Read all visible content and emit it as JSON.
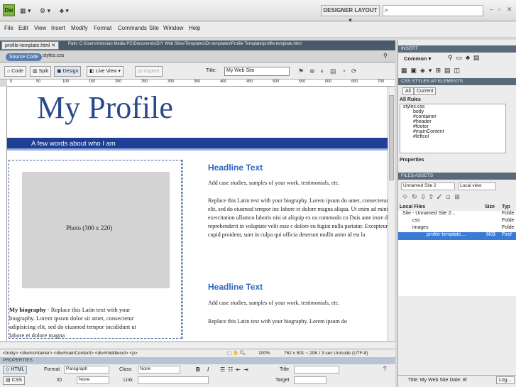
{
  "app": {
    "logo": "Dw",
    "layout": "DESIGNER LAYOUT",
    "search_placeholder": ""
  },
  "menu": [
    "File",
    "Edit",
    "View",
    "Insert",
    "Modify",
    "Format",
    "Commands",
    "Site",
    "Window",
    "Help"
  ],
  "doc": {
    "tab": "profile-template.html",
    "path": "Path: C:\\Users\\Artesian Media PC\\Documents\\DIY Web Sites\\Templates\\Dr-templates\\Profile Template\\profile-template.html",
    "source": "Source Code",
    "related": "styles.css"
  },
  "toolbar": {
    "code": "Code",
    "split": "Split",
    "design": "Design",
    "live": "Live View",
    "inspect": "Inspect",
    "title_label": "Title:",
    "title_value": "My Web Site"
  },
  "ruler": [
    "0",
    "50",
    "100",
    "150",
    "200",
    "250",
    "300",
    "350",
    "400",
    "450",
    "500",
    "550",
    "600",
    "650",
    "700"
  ],
  "page": {
    "heading": "My Profile",
    "tagline": "A few words about who I am",
    "photo": "Photo (300 x 220)",
    "bio_label": "My biography",
    "bio": " - Replace this Latin text with your biography. Lorem ipsum dolor sit amet, consectetur adipisicing elit, sed do eiusmod tempor incididunt ut labore et dolore magna",
    "h1": "Headline Text",
    "p1": "Add case studies, samples of your work, testimonials, etc.",
    "p2": "Replace this Latin text with your biography. Lorem ipsum do amet, consectetur adipisicing elit, sed do eiusmod tempor inc labore et dolore magna aliqua. Ut enim ad minim veniam, qui exercitation ullamco laboris nisi ut aliquip ex ea commodo co Duis aute irure dolor in reprehenderit in voluptate velit esse c dolore eu fugiat nulla pariatur. Excepteur sint occaecat cupid proident, sunt in culpa qui officia deserunt mollit anim id est la",
    "h2": "Headline Text",
    "p3": "Add case studies, samples of your work, testimonials, etc.",
    "p4": "Replace this Latin text with your biography. Lorem ipsum do"
  },
  "status": {
    "tags": "<body> <div#container> <div#mainContent> <div#middlecol> <p>",
    "zoom": "100%",
    "size": "762 x 501 ~ 20K / 3 sec Unicode (UTF-8)"
  },
  "properties": {
    "title": "PROPERTIES",
    "html": "HTML",
    "css": "CSS",
    "format_label": "Format",
    "format_val": "Paragraph",
    "class_label": "Class",
    "class_val": "None",
    "id_label": "ID",
    "id_val": "None",
    "link_label": "Link",
    "title_label": "Title",
    "target_label": "Target",
    "bold": "B",
    "italic": "I"
  },
  "panels": {
    "insert": "INSERT",
    "common": "Common",
    "css_tab": "CSS STYLES",
    "ap_tab": "AP ELEMENTS",
    "all": "All",
    "current": "Current",
    "all_rules": "All Rules",
    "rules": [
      "styles.css",
      "body",
      "#container",
      "#header",
      "#footer",
      "#mainContent",
      "#leftcol"
    ],
    "properties": "Properties",
    "files_tab": "FILES",
    "assets_tab": "ASSETS",
    "site": "Unnamed Site 2",
    "view": "Local view",
    "local_files": "Local Files",
    "size": "Size",
    "type": "Typ",
    "files": [
      {
        "name": "Site - Unnamed Site 2...",
        "size": "",
        "type": "Folde"
      },
      {
        "name": "css",
        "size": "",
        "type": "Folde"
      },
      {
        "name": "images",
        "size": "",
        "type": "Folde"
      },
      {
        "name": "profile-template....",
        "size": "6KB",
        "type": "Firef"
      }
    ],
    "footer": "Title: My Web Site  Date: 8/",
    "log": "Log..."
  }
}
